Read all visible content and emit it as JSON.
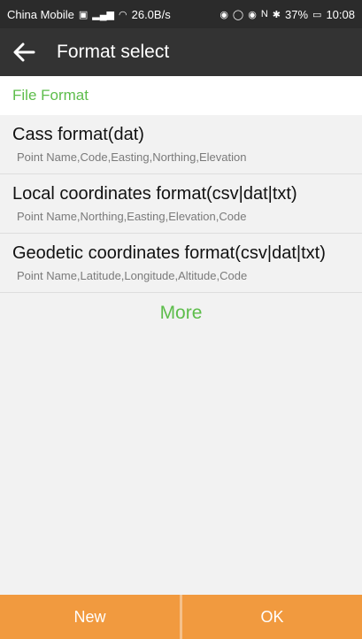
{
  "status_bar": {
    "carrier": "China Mobile",
    "speed": "26.0B/s",
    "battery": "37%",
    "time": "10:08"
  },
  "toolbar": {
    "title": "Format select",
    "back_icon": "arrow-left-icon"
  },
  "section": {
    "title": "File Format"
  },
  "formats": [
    {
      "title": "Cass format(dat)",
      "fields": "Point Name,Code,Easting,Northing,Elevation"
    },
    {
      "title": "Local coordinates format(csv|dat|txt)",
      "fields": "Point Name,Northing,Easting,Elevation,Code"
    },
    {
      "title": "Geodetic coordinates format(csv|dat|txt)",
      "fields": "Point Name,Latitude,Longitude,Altitude,Code"
    }
  ],
  "more_label": "More",
  "buttons": {
    "new_label": "New",
    "ok_label": "OK"
  },
  "colors": {
    "accent_green": "#5dbd4b",
    "button_orange": "#f19a3f",
    "toolbar": "#333333"
  }
}
